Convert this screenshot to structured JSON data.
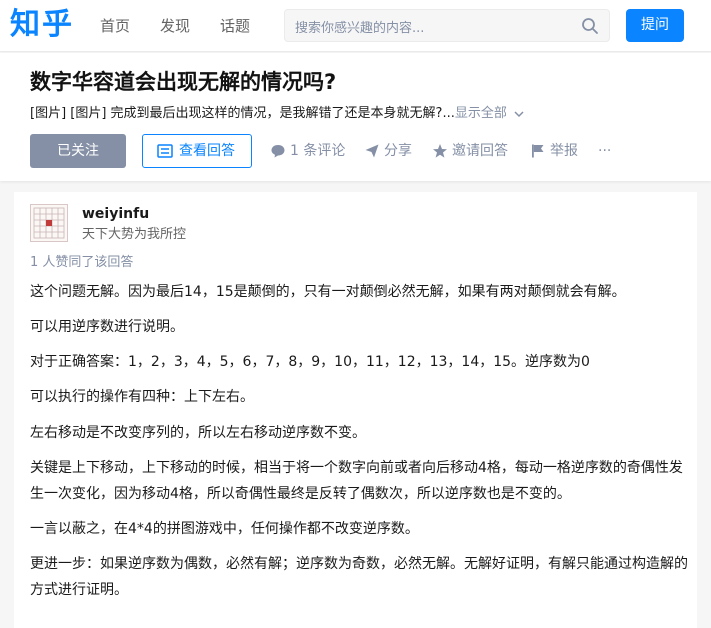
{
  "nav": {
    "logo": "知乎",
    "links": [
      "首页",
      "发现",
      "话题"
    ],
    "search_placeholder": "搜索你感兴趣的内容...",
    "ask": "提问"
  },
  "question": {
    "title": "数字华容道会出现无解的情况吗?",
    "desc": "[图片] [图片] 完成到最后出现这样的情况，是我解错了还是本身就无解?...",
    "show_all": "显示全部",
    "follow": "已关注",
    "view_answers": "查看回答",
    "comments": "1 条评论",
    "share": "分享",
    "invite": "邀请回答",
    "report": "举报",
    "more": "···"
  },
  "answer": {
    "author": "weiyinfu",
    "bio": "天下大势为我所控",
    "votes": "1 人赞同了该回答",
    "paragraphs": [
      "这个问题无解。因为最后14，15是颠倒的，只有一对颠倒必然无解，如果有两对颠倒就会有解。",
      "可以用逆序数进行说明。",
      "对于正确答案：1，2，3，4，5，6，7，8，9，10，11，12，13，14，15。逆序数为0",
      "可以执行的操作有四种：上下左右。",
      "左右移动是不改变序列的，所以左右移动逆序数不变。",
      "关键是上下移动，上下移动的时候，相当于将一个数字向前或者向后移动4格，每动一格逆序数的奇偶性发生一次变化，因为移动4格，所以奇偶性最终是反转了偶数次，所以逆序数也是不变的。",
      "一言以蔽之，在4*4的拼图游戏中，任何操作都不改变逆序数。",
      "更进一步：如果逆序数为偶数，必然有解；逆序数为奇数，必然无解。无解好证明，有解只能通过构造解的方式进行证明。"
    ]
  },
  "colors": {
    "brand": "#0a84ff",
    "muted": "#8590a6"
  }
}
